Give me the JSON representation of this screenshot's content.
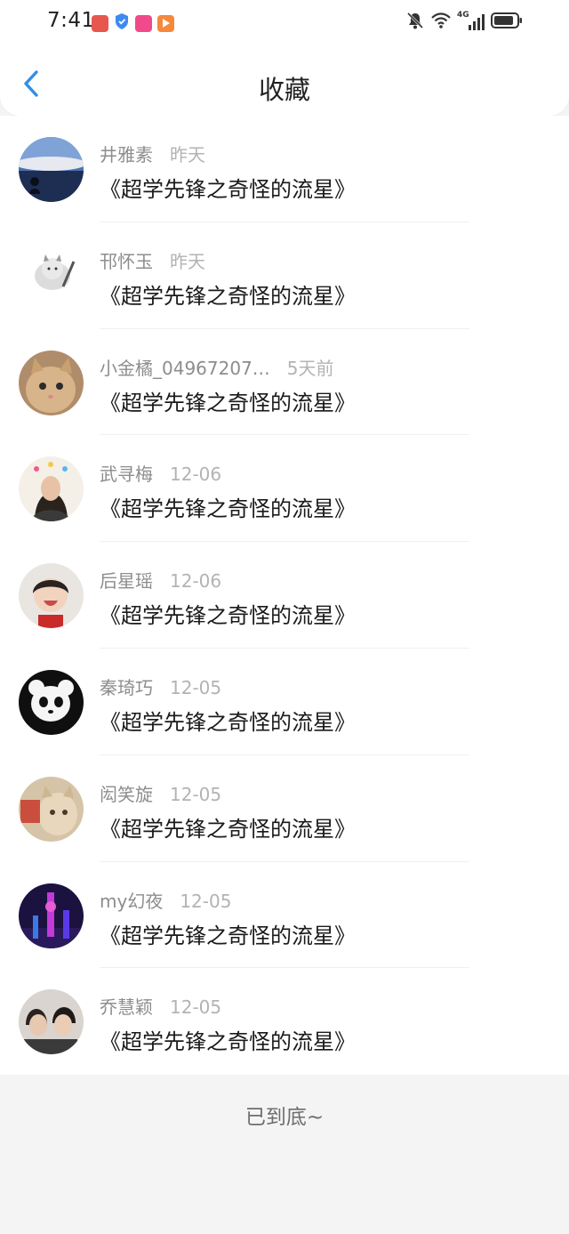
{
  "status_bar": {
    "time": "7:41",
    "network": "4G",
    "colors": {
      "app1": "#e8574f",
      "app2": "#3d8bf2",
      "app3": "#f04a8a",
      "app4": "#f5883a"
    }
  },
  "header": {
    "title": "收藏",
    "back_icon": "chevron-left-icon",
    "accent": "#2f8fe6"
  },
  "items": [
    {
      "name": "井雅素",
      "date": "昨天",
      "content": "《超学先锋之奇怪的流星》"
    },
    {
      "name": "邗怀玉",
      "date": "昨天",
      "content": "《超学先锋之奇怪的流星》"
    },
    {
      "name": "小金橘_04967207…",
      "date": "5天前",
      "content": "《超学先锋之奇怪的流星》"
    },
    {
      "name": "武寻梅",
      "date": "12-06",
      "content": "《超学先锋之奇怪的流星》"
    },
    {
      "name": "后星瑶",
      "date": "12-06",
      "content": "《超学先锋之奇怪的流星》"
    },
    {
      "name": "秦琦巧",
      "date": "12-05",
      "content": "《超学先锋之奇怪的流星》"
    },
    {
      "name": "闳笑旋",
      "date": "12-05",
      "content": "《超学先锋之奇怪的流星》"
    },
    {
      "name": "my幻夜",
      "date": "12-05",
      "content": "《超学先锋之奇怪的流星》"
    },
    {
      "name": "乔慧颖",
      "date": "12-05",
      "content": "《超学先锋之奇怪的流星》"
    }
  ],
  "footer": {
    "end_text": "已到底~"
  }
}
